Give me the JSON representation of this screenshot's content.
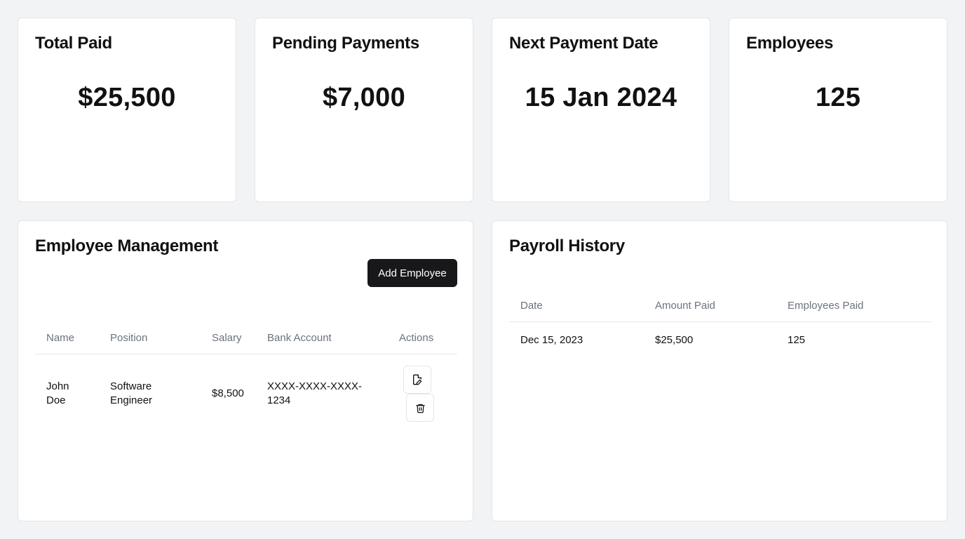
{
  "stats": {
    "total_paid": {
      "title": "Total Paid",
      "value": "$25,500"
    },
    "pending_payments": {
      "title": "Pending Payments",
      "value": "$7,000"
    },
    "next_payment_date": {
      "title": "Next Payment Date",
      "value": "15 Jan 2024"
    },
    "employees": {
      "title": "Employees",
      "value": "125"
    }
  },
  "employee_management": {
    "title": "Employee Management",
    "add_button_label": "Add Employee",
    "columns": [
      "Name",
      "Position",
      "Salary",
      "Bank Account",
      "Actions"
    ],
    "rows": [
      {
        "name": "John Doe",
        "position": "Software Engineer",
        "salary": "$8,500",
        "bank_account": "XXXX-XXXX-XXXX-1234",
        "actions": [
          "edit-file-icon",
          "trash-icon"
        ]
      }
    ]
  },
  "payroll_history": {
    "title": "Payroll History",
    "columns": [
      "Date",
      "Amount Paid",
      "Employees Paid"
    ],
    "rows": [
      {
        "date": "Dec 15, 2023",
        "amount_paid": "$25,500",
        "employees_paid": "125"
      }
    ]
  },
  "colors": {
    "background": "#f2f3f5",
    "card": "#ffffff",
    "primary_button": "#18181b",
    "header_text": "#6b7280"
  }
}
